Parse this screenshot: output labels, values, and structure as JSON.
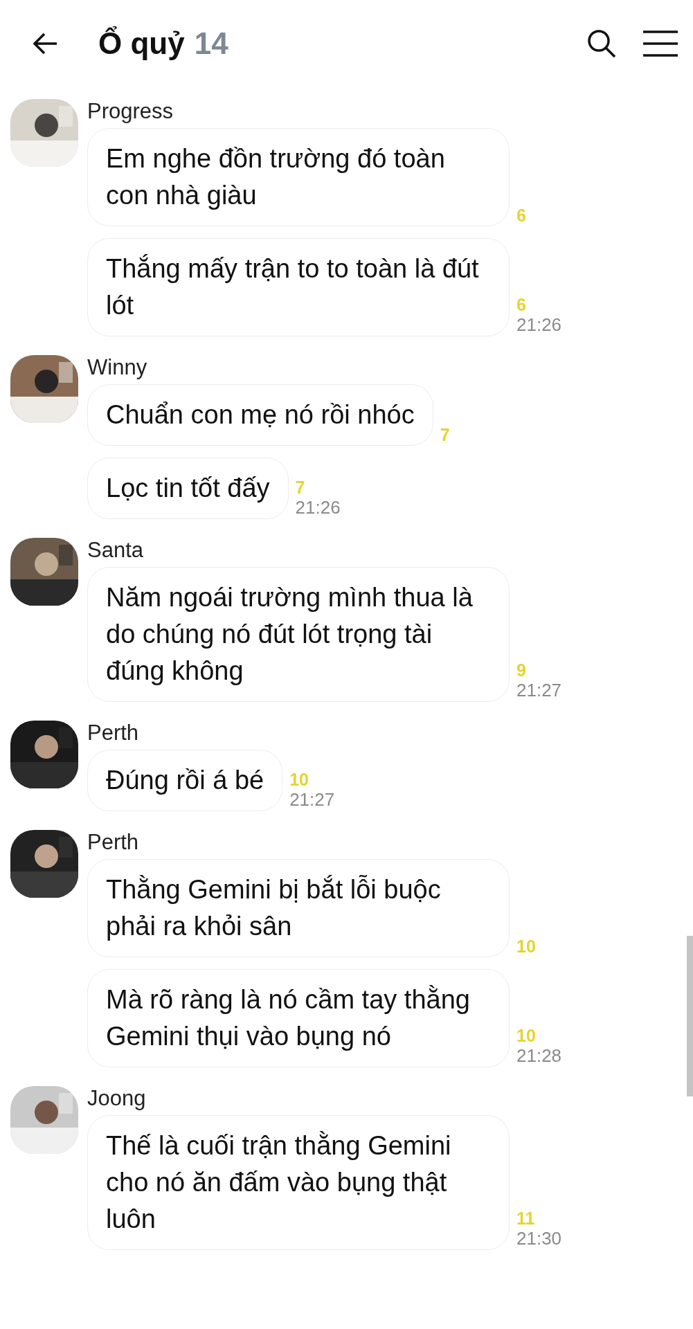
{
  "header": {
    "title": "Ổ quỷ",
    "member_count": "14"
  },
  "groups": [
    {
      "sender": "Progress",
      "messages": [
        {
          "text": "Em nghe đồn trường đó toàn con nhà giàu",
          "read": "6"
        },
        {
          "text": "Thắng mấy trận to to toàn là đút lót",
          "read": "6",
          "time": "21:26"
        }
      ]
    },
    {
      "sender": "Winny",
      "messages": [
        {
          "text": "Chuẩn con mẹ nó rồi nhóc",
          "read": "7"
        },
        {
          "text": "Lọc tin tốt đấy",
          "read": "7",
          "time": "21:26"
        }
      ]
    },
    {
      "sender": "Santa",
      "messages": [
        {
          "text": "Năm ngoái trường mình thua là do chúng nó đút lót trọng tài đúng không",
          "read": "9",
          "time": "21:27"
        }
      ]
    },
    {
      "sender": "Perth",
      "messages": [
        {
          "text": "Đúng rồi á bé",
          "read": "10",
          "time": "21:27"
        }
      ]
    },
    {
      "sender": "Perth",
      "messages": [
        {
          "text": "Thằng Gemini bị bắt lỗi buộc phải ra khỏi sân",
          "read": "10"
        },
        {
          "text": "Mà rõ ràng là nó cầm tay thằng Gemini thụi vào bụng nó",
          "read": "10",
          "time": "21:28"
        }
      ]
    },
    {
      "sender": "Joong",
      "messages": [
        {
          "text": "Thế là cuối trận thằng Gemini cho nó ăn đấm vào bụng thật luôn",
          "read": "11",
          "time": "21:30"
        }
      ]
    }
  ]
}
